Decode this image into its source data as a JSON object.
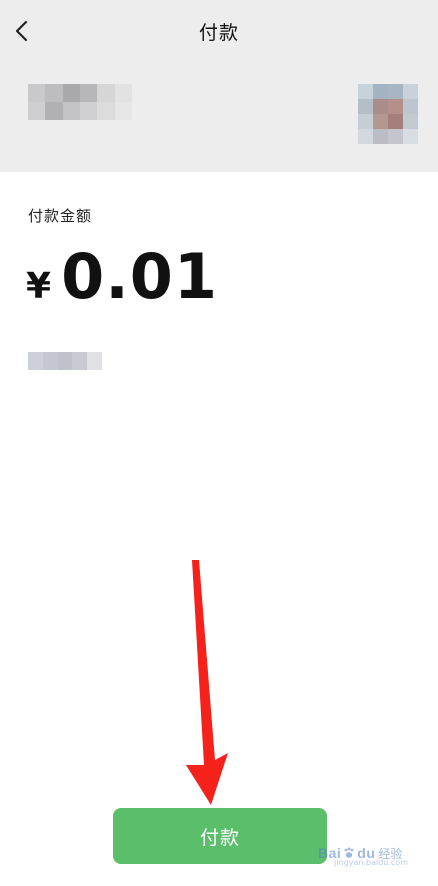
{
  "header": {
    "title": "付款",
    "back_icon": "chevron-left-icon"
  },
  "payee": {
    "name_blurred": true,
    "avatar_blurred": true
  },
  "payment": {
    "amount_label": "付款金额",
    "currency_symbol": "¥",
    "amount": "0.01",
    "note_blurred": true
  },
  "actions": {
    "pay_label": "付款"
  },
  "colors": {
    "header_bg": "#ededed",
    "pay_button": "#5bbe6b",
    "arrow": "#f5221b"
  },
  "watermark": {
    "brand": "Bai",
    "brand_suffix": "du",
    "sub": "经验",
    "url": "jingyan.baidu.com"
  }
}
